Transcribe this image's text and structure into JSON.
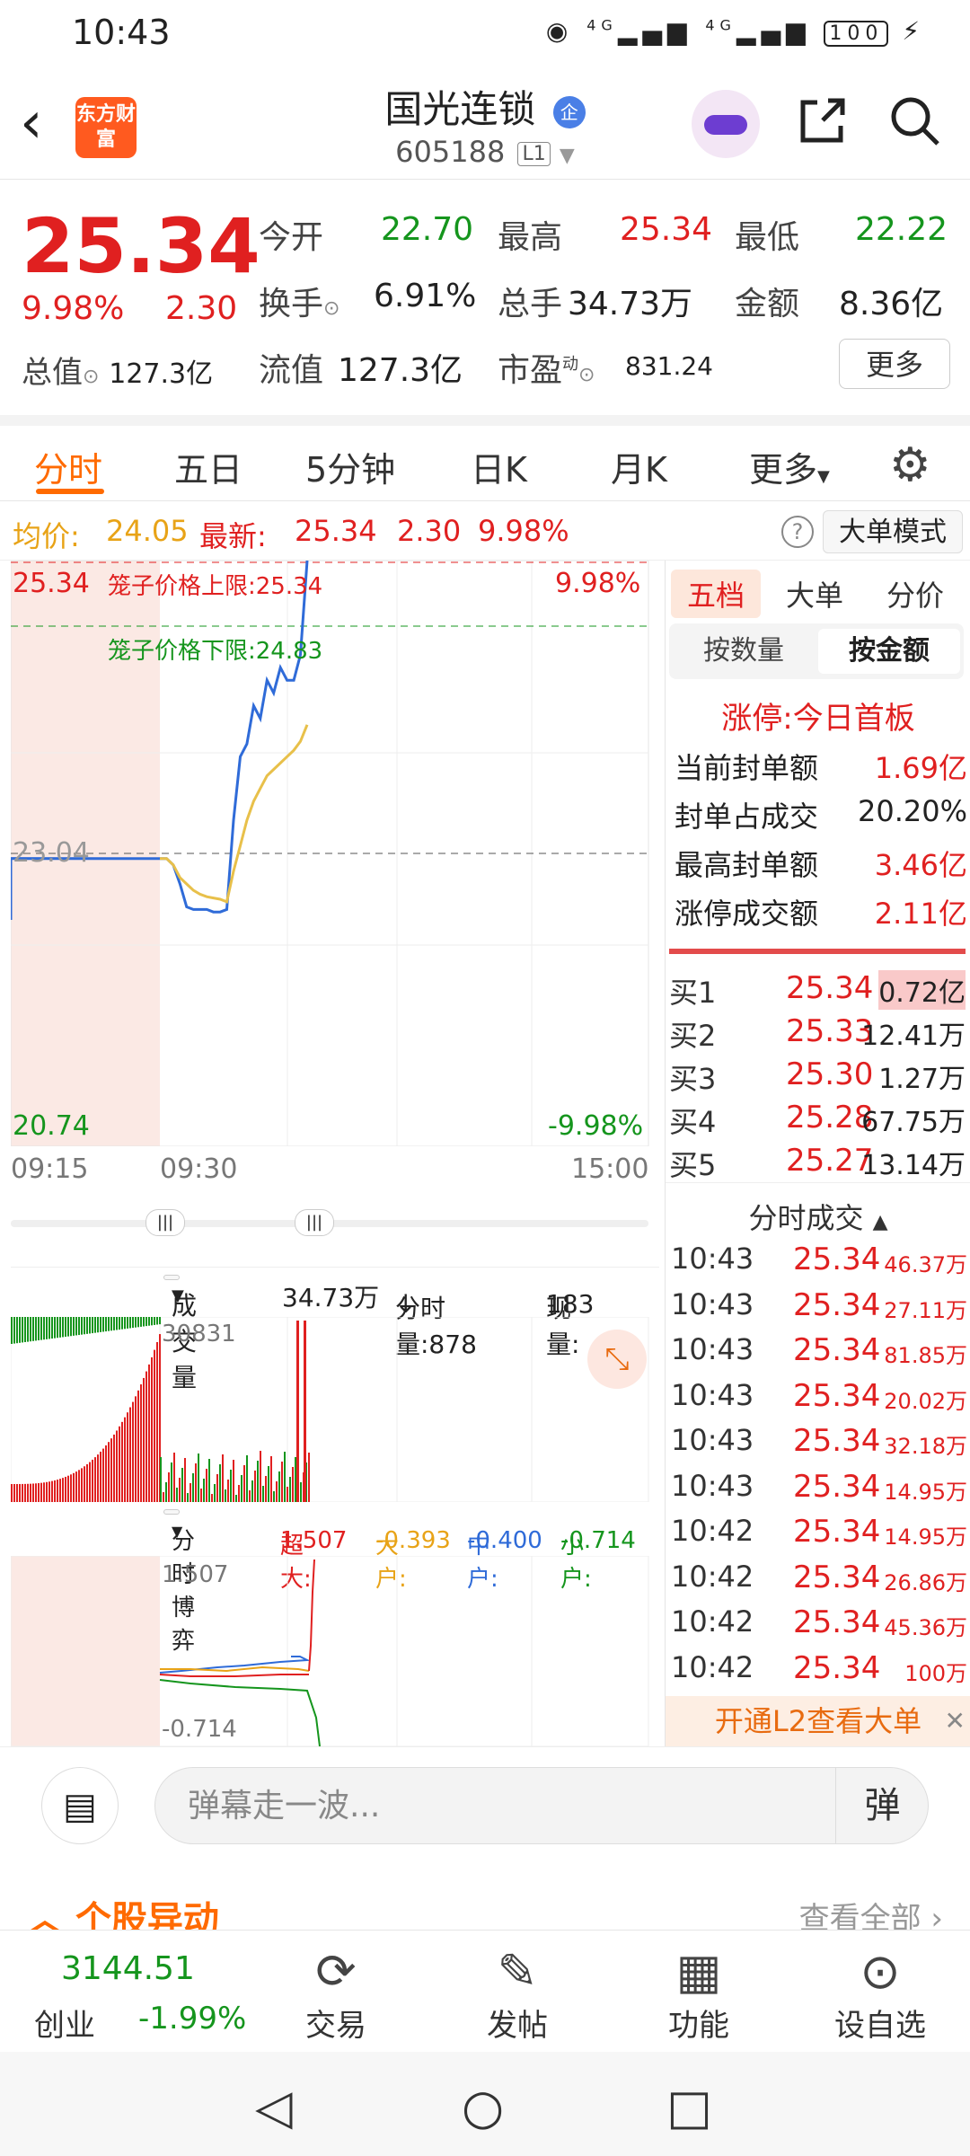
{
  "status": {
    "time": "10:43",
    "battery": "100",
    "net1": "4G",
    "net2": "4G"
  },
  "header": {
    "logo": "东方财富",
    "title": "国光连锁",
    "title_tag": "企",
    "code": "605188",
    "level": "L1"
  },
  "quote": {
    "price": "25.34",
    "pct": "9.98%",
    "chg": "2.30",
    "open_label": "今开",
    "open": "22.70",
    "high_label": "最高",
    "high": "25.34",
    "low_label": "最低",
    "low": "22.22",
    "turnover_label": "换手",
    "turnover": "6.91%",
    "vol_label": "总手",
    "vol": "34.73万",
    "amount_label": "金额",
    "amount": "8.36亿",
    "mv_label": "总值",
    "mv": "127.3亿",
    "float_label": "流值",
    "float": "127.3亿",
    "pe_label": "市盈",
    "pe_sup": "动",
    "pe": "831.24",
    "more": "更多"
  },
  "tabs": [
    "分时",
    "五日",
    "5分钟",
    "日K",
    "月K",
    "更多"
  ],
  "infoline": {
    "avg_label": "均价:",
    "avg": "24.05",
    "latest_label": "最新:",
    "latest": "25.34",
    "chg": "2.30",
    "pct": "9.98%",
    "big_mode": "大单模式"
  },
  "chart": {
    "top_price": "25.34",
    "top_pct": "9.98%",
    "mid_price": "23.04",
    "bottom_price": "20.74",
    "bottom_pct": "-9.98%",
    "upper_cage_label": "笼子价格上限:",
    "upper_cage": "25.34",
    "lower_cage_label": "笼子价格下限:",
    "lower_cage": "24.83",
    "time_start": "09:15",
    "time_mid": "09:30",
    "time_end": "15:00"
  },
  "chart_data": {
    "type": "line",
    "ylim": [
      20.74,
      25.34
    ],
    "reference": 23.04,
    "series": [
      {
        "values": [
          23.0,
          23.0,
          22.95,
          22.8,
          22.62,
          22.6,
          22.6,
          22.6,
          22.58,
          22.58,
          22.6,
          23.3,
          23.8,
          23.9,
          24.2,
          24.1,
          24.4,
          24.3,
          24.5,
          24.4,
          24.4,
          24.6,
          25.34
        ]
      },
      {
        "values": [
          23.0,
          23.0,
          22.95,
          22.85,
          22.8,
          22.75,
          22.72,
          22.7,
          22.69,
          22.68,
          22.66,
          22.9,
          23.1,
          23.3,
          23.45,
          23.55,
          23.65,
          23.7,
          23.75,
          23.8,
          23.85,
          23.92,
          24.05
        ]
      }
    ]
  },
  "volume": {
    "dropdown": "成交量",
    "total": "34.73万",
    "per_min": "分时量:878",
    "arrow": "↓",
    "cur_label": "现量:",
    "cur": "183",
    "max": "30831"
  },
  "game": {
    "dropdown": "分时博弈",
    "super_label": "超大:",
    "super": "1.507",
    "big_label": "大户:",
    "big": "-0.393",
    "mid_label": "中户:",
    "mid": "-0.400",
    "small_label": "小户:",
    "small": "-0.714",
    "top": "1.507",
    "bottom": "-0.714"
  },
  "right": {
    "tabs": [
      "五档",
      "大单",
      "分价"
    ],
    "seg": [
      "按数量",
      "按金额"
    ],
    "limit_title": "涨停:今日首板",
    "rows": [
      {
        "label": "当前封单额",
        "value": "1.69亿",
        "color": "#e02020"
      },
      {
        "label": "封单占成交",
        "value": "20.20%",
        "color": "#222222"
      },
      {
        "label": "最高封单额",
        "value": "3.46亿",
        "color": "#e02020"
      },
      {
        "label": "涨停成交额",
        "value": "2.11亿",
        "color": "#e02020"
      }
    ],
    "orderbook": [
      {
        "name": "买1",
        "price": "25.34",
        "qty": "0.72亿"
      },
      {
        "name": "买2",
        "price": "25.33",
        "qty": "12.41万"
      },
      {
        "name": "买3",
        "price": "25.30",
        "qty": "1.27万"
      },
      {
        "name": "买4",
        "price": "25.28",
        "qty": "67.75万"
      },
      {
        "name": "买5",
        "price": "25.27",
        "qty": "13.14万"
      }
    ],
    "ticks_title": "分时成交",
    "ticks": [
      {
        "t": "10:43",
        "p": "25.34",
        "v": "46.37万"
      },
      {
        "t": "10:43",
        "p": "25.34",
        "v": "27.11万"
      },
      {
        "t": "10:43",
        "p": "25.34",
        "v": "81.85万"
      },
      {
        "t": "10:43",
        "p": "25.34",
        "v": "20.02万"
      },
      {
        "t": "10:43",
        "p": "25.34",
        "v": "32.18万"
      },
      {
        "t": "10:43",
        "p": "25.34",
        "v": "14.95万"
      },
      {
        "t": "10:42",
        "p": "25.34",
        "v": "14.95万"
      },
      {
        "t": "10:42",
        "p": "25.34",
        "v": "26.86万"
      },
      {
        "t": "10:42",
        "p": "25.34",
        "v": "45.36万"
      },
      {
        "t": "10:42",
        "p": "25.34",
        "v": "100万"
      }
    ],
    "l2": "开通L2查看大单"
  },
  "comment": {
    "placeholder": "弹幕走一波...",
    "danmu": "弹"
  },
  "stockmove": {
    "title": "个股异动",
    "link": "查看全部"
  },
  "bottomnav": {
    "index_value": "3144.51",
    "index_name": "创业",
    "index_chg": "-1.99%",
    "items": [
      "交易",
      "发帖",
      "功能",
      "设自选"
    ]
  }
}
